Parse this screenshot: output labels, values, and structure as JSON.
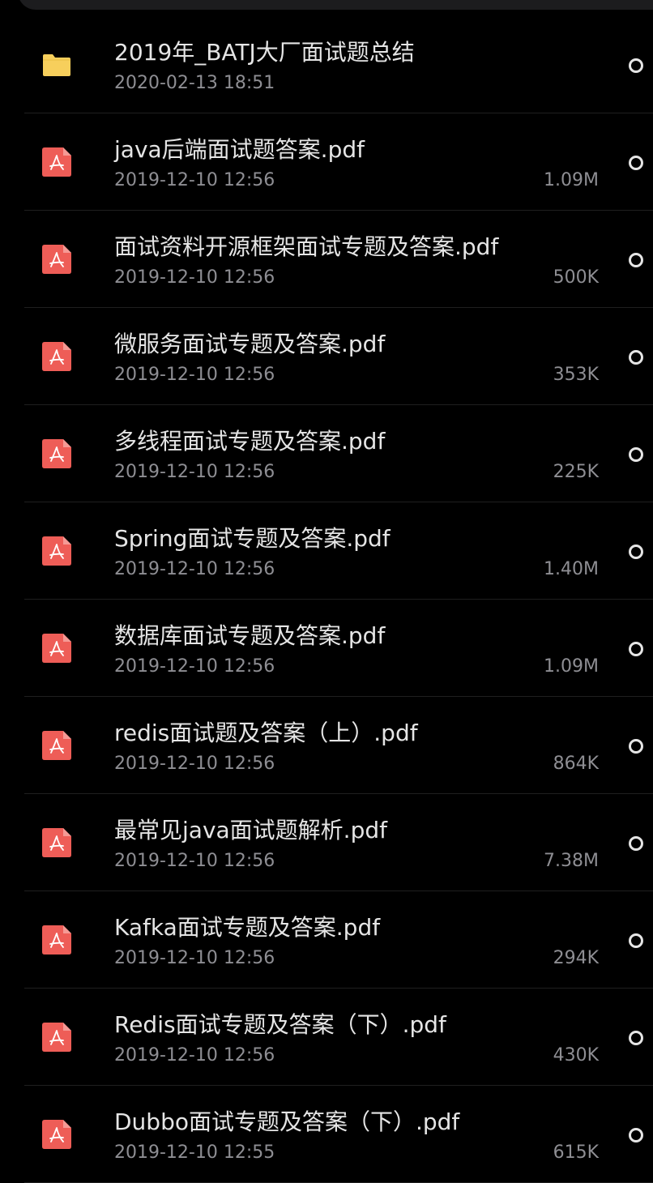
{
  "colors": {
    "background": "#000000",
    "folder": "#f7cf5c",
    "pdf": "#ee5d57",
    "title_text": "#e5e5e5",
    "meta_text": "#8e8e93"
  },
  "files": [
    {
      "type": "folder",
      "icon": "folder-icon",
      "name": "2019年_BATJ大厂面试题总结",
      "date": "2020-02-13 18:51",
      "size": ""
    },
    {
      "type": "pdf",
      "icon": "pdf-icon",
      "name": "java后端面试题答案.pdf",
      "date": "2019-12-10 12:56",
      "size": "1.09M"
    },
    {
      "type": "pdf",
      "icon": "pdf-icon",
      "name": "面试资料开源框架面试专题及答案.pdf",
      "date": "2019-12-10 12:56",
      "size": "500K"
    },
    {
      "type": "pdf",
      "icon": "pdf-icon",
      "name": "微服务面试专题及答案.pdf",
      "date": "2019-12-10 12:56",
      "size": "353K"
    },
    {
      "type": "pdf",
      "icon": "pdf-icon",
      "name": "多线程面试专题及答案.pdf",
      "date": "2019-12-10 12:56",
      "size": "225K"
    },
    {
      "type": "pdf",
      "icon": "pdf-icon",
      "name": "Spring面试专题及答案.pdf",
      "date": "2019-12-10 12:56",
      "size": "1.40M"
    },
    {
      "type": "pdf",
      "icon": "pdf-icon",
      "name": "数据库面试专题及答案.pdf",
      "date": "2019-12-10 12:56",
      "size": "1.09M"
    },
    {
      "type": "pdf",
      "icon": "pdf-icon",
      "name": "redis面试题及答案（上）.pdf",
      "date": "2019-12-10 12:56",
      "size": "864K"
    },
    {
      "type": "pdf",
      "icon": "pdf-icon",
      "name": "最常见java面试题解析.pdf",
      "date": "2019-12-10 12:56",
      "size": "7.38M"
    },
    {
      "type": "pdf",
      "icon": "pdf-icon",
      "name": "Kafka面试专题及答案.pdf",
      "date": "2019-12-10 12:56",
      "size": "294K"
    },
    {
      "type": "pdf",
      "icon": "pdf-icon",
      "name": "Redis面试专题及答案（下）.pdf",
      "date": "2019-12-10 12:56",
      "size": "430K"
    },
    {
      "type": "pdf",
      "icon": "pdf-icon",
      "name": "Dubbo面试专题及答案（下）.pdf",
      "date": "2019-12-10 12:55",
      "size": "615K"
    }
  ]
}
